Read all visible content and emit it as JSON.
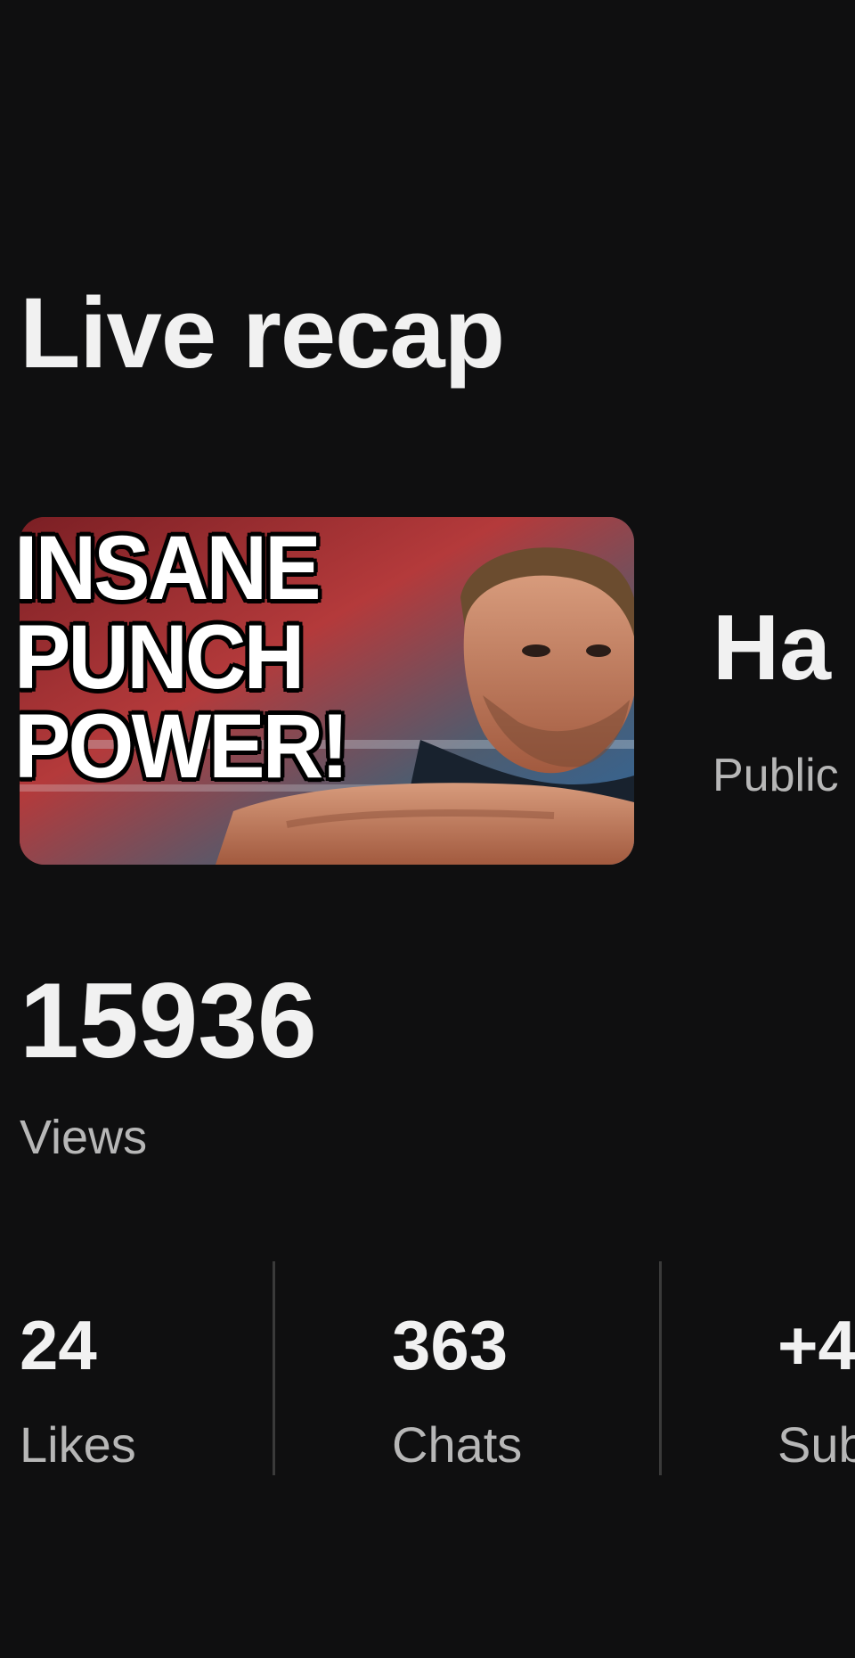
{
  "header": {
    "title": "Live recap"
  },
  "video": {
    "thumbnail_text": [
      "INSANE",
      "PUNCH",
      "POWER!"
    ],
    "title_partial": "Ha",
    "visibility_partial": "Public"
  },
  "metrics": {
    "views_value": "15936",
    "views_label": "Views",
    "stats": [
      {
        "value": "24",
        "label": "Likes"
      },
      {
        "value": "363",
        "label": "Chats"
      },
      {
        "value": "+4",
        "label": "Sub"
      }
    ]
  },
  "colors": {
    "background": "#0f0f10",
    "primary_text": "#f1f1f1",
    "secondary_text": "#b7b7b7",
    "divider": "#3a3a3a"
  }
}
